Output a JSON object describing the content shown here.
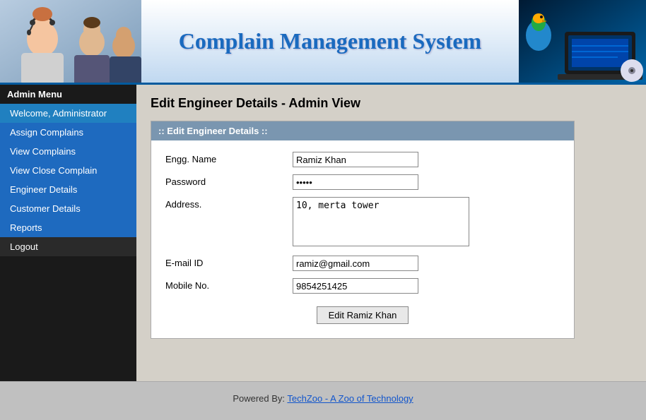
{
  "header": {
    "title": "Complain Management System"
  },
  "sidebar": {
    "menu_label": "Admin Menu",
    "items": [
      {
        "id": "welcome",
        "label": "Welcome, Administrator",
        "class": "welcome"
      },
      {
        "id": "assign-complains",
        "label": "Assign Complains",
        "class": "blue"
      },
      {
        "id": "view-complains",
        "label": "View Complains",
        "class": "blue"
      },
      {
        "id": "view-close-complain",
        "label": "View Close Complain",
        "class": "blue"
      },
      {
        "id": "engineer-details",
        "label": "Engineer Details",
        "class": "blue"
      },
      {
        "id": "customer-details",
        "label": "Customer Details",
        "class": "blue"
      },
      {
        "id": "reports",
        "label": "Reports",
        "class": "blue"
      },
      {
        "id": "logout",
        "label": "Logout",
        "class": "dark"
      }
    ]
  },
  "content": {
    "page_title": "Edit Engineer Details - Admin View",
    "form": {
      "box_header": ":: Edit Engineer Details ::",
      "fields": {
        "engg_name_label": "Engg. Name",
        "engg_name_value": "Ramiz Khan",
        "password_label": "Password",
        "password_value": "•••••",
        "address_label": "Address.",
        "address_value": "10, merta tower",
        "email_label": "E-mail ID",
        "email_value": "ramiz@gmail.com",
        "mobile_label": "Mobile No.",
        "mobile_value": "9854251425"
      },
      "submit_label": "Edit Ramiz Khan"
    }
  },
  "footer": {
    "text": "Powered By: ",
    "link_text": "TechZoo - A Zoo of Technology",
    "link_url": "#"
  }
}
